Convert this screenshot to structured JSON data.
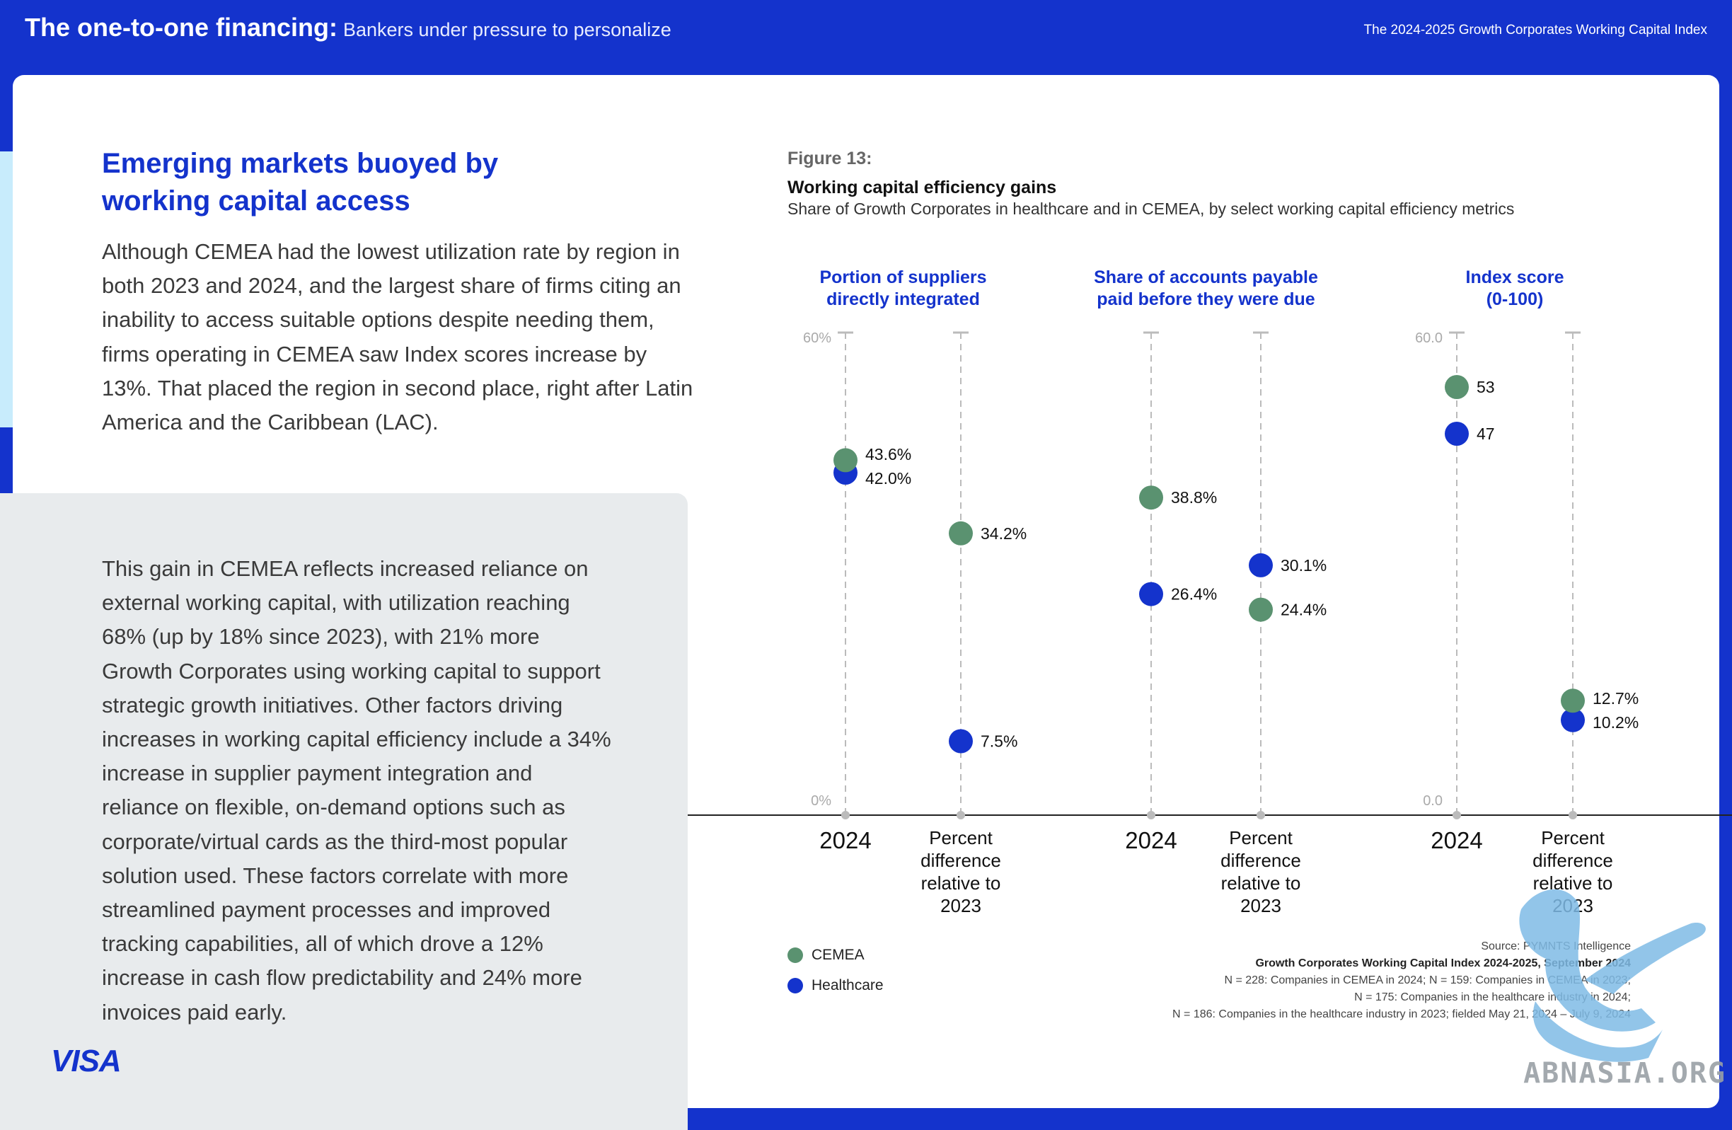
{
  "header": {
    "title": "The one-to-one financing:",
    "subtitle": "Bankers under pressure to personalize",
    "right": "The 2024-2025 Growth Corporates Working Capital Index"
  },
  "article": {
    "headline": "Emerging markets buoyed by working capital access",
    "para1": "Although CEMEA had the lowest utilization rate by region in both 2023 and 2024, and the largest share of firms citing an inability to access suitable options despite needing them, firms operating in CEMEA saw Index scores increase by 13%. That placed the region in second place, right after Latin America and the Caribbean (LAC).",
    "para2": "This gain in CEMEA reflects increased reliance on external working capital, with utilization reaching 68% (up by 18% since 2023), with 21% more Growth Corporates using working capital to support strategic growth initiatives. Other factors driving increases in working capital efficiency include a 34% increase in supplier payment integration and reliance on flexible, on-demand options such as corporate/virtual cards as the third-most popular solution used. These factors correlate with more streamlined payment processes and improved tracking capabilities, all of which drove a 12% increase in cash flow predictability and 24% more invoices paid early."
  },
  "brand": {
    "logo_text": "VISA"
  },
  "figure": {
    "label": "Figure 13:",
    "title": "Working capital efficiency gains",
    "subtitle": "Share of Growth Corporates in healthcare and in CEMEA, by select working capital efficiency metrics"
  },
  "colors": {
    "cemea": "#5a9270",
    "healthcare": "#1433cc",
    "accent": "#1433cc",
    "axis": "#bbbbbb"
  },
  "chart_data": {
    "type": "scatter",
    "series_names": [
      "CEMEA",
      "Healthcare"
    ],
    "x_labels": {
      "year": "2024",
      "diff": [
        "Percent",
        "difference",
        "relative to",
        "2023"
      ]
    },
    "panels": [
      {
        "title": [
          "Portion of suppliers",
          "directly integrated"
        ],
        "ylim": [
          0,
          60
        ],
        "ymin_label": "0%",
        "ymax_label": "60%",
        "columns": [
          {
            "x": "2024",
            "values": {
              "CEMEA": 43.6,
              "Healthcare": 42.0
            },
            "labels": {
              "CEMEA": "43.6%",
              "Healthcare": "42.0%"
            }
          },
          {
            "x": "Percent difference relative to 2023",
            "values": {
              "CEMEA": 34.2,
              "Healthcare": 7.5
            },
            "labels": {
              "CEMEA": "34.2%",
              "Healthcare": "7.5%"
            }
          }
        ]
      },
      {
        "title": [
          "Share of accounts payable",
          "paid before they were due"
        ],
        "ylim": [
          0,
          60
        ],
        "ymin_label": "",
        "ymax_label": "",
        "columns": [
          {
            "x": "2024",
            "values": {
              "CEMEA": 38.8,
              "Healthcare": 26.4
            },
            "labels": {
              "CEMEA": "38.8%",
              "Healthcare": "26.4%"
            }
          },
          {
            "x": "Percent difference relative to 2023",
            "values": {
              "CEMEA": 24.4,
              "Healthcare": 30.1
            },
            "labels": {
              "CEMEA": "24.4%",
              "Healthcare": "30.1%"
            }
          }
        ]
      },
      {
        "title": [
          "Index score",
          "(0-100)"
        ],
        "ylim": [
          0,
          60
        ],
        "ymin_label": "0.0",
        "ymax_label": "60.0",
        "columns": [
          {
            "x": "2024",
            "values": {
              "CEMEA": 53,
              "Healthcare": 47
            },
            "labels": {
              "CEMEA": "53",
              "Healthcare": "47"
            }
          },
          {
            "x": "Percent difference relative to 2023",
            "values": {
              "CEMEA": 12.7,
              "Healthcare": 10.2
            },
            "labels": {
              "CEMEA": "12.7%",
              "Healthcare": "10.2%"
            }
          }
        ]
      }
    ],
    "legend": [
      "CEMEA",
      "Healthcare"
    ],
    "legend_position": "bottom-left",
    "grid": false
  },
  "source": {
    "line1": "Source: PYMNTS Intelligence",
    "line2": "Growth Corporates Working Capital Index 2024-2025, September 2024",
    "line3": "N = 228: Companies in CEMEA in 2024; N = 159: Companies in CEMEA in 2023;",
    "line4": "N = 175: Companies in the healthcare industry in 2024;",
    "line5": "N = 186: Companies in the healthcare industry in 2023; fielded May 21, 2024 – July 9, 2024"
  },
  "watermark": {
    "text": "ABNASIA.ORG"
  }
}
